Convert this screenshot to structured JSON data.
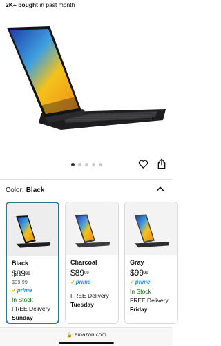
{
  "header": {
    "bought_bold": "2K+ bought",
    "bought_rest": " in past month"
  },
  "gallery": {
    "dots": 5,
    "active_dot": 0
  },
  "colors": {
    "label": "Color:",
    "selected": "Black"
  },
  "variants": [
    {
      "name": "Black",
      "price_whole": "$89",
      "price_fraction": "99",
      "list_price": "$99.99",
      "prime": "prime",
      "stock": "In Stock",
      "delivery": "FREE Delivery",
      "day": "Sunday"
    },
    {
      "name": "Charcoal",
      "price_whole": "$89",
      "price_fraction": "99",
      "list_price": "",
      "prime": "prime",
      "stock": "",
      "delivery": "FREE Delivery",
      "day": "Tuesday"
    },
    {
      "name": "Gray",
      "price_whole": "$99",
      "price_fraction": "99",
      "list_price": "",
      "prime": "prime",
      "stock": "In Stock",
      "delivery": "FREE Delivery",
      "day": "Friday"
    }
  ],
  "browser": {
    "url": "amazon.com"
  },
  "icons": {
    "wishlist": "heart-icon",
    "share": "share-icon",
    "collapse": "chevron-up-icon",
    "lock": "lock-icon"
  },
  "theme": {
    "selected_border": "#2c7b89",
    "in_stock": "#007600",
    "prime_blue": "#1a98ff"
  }
}
